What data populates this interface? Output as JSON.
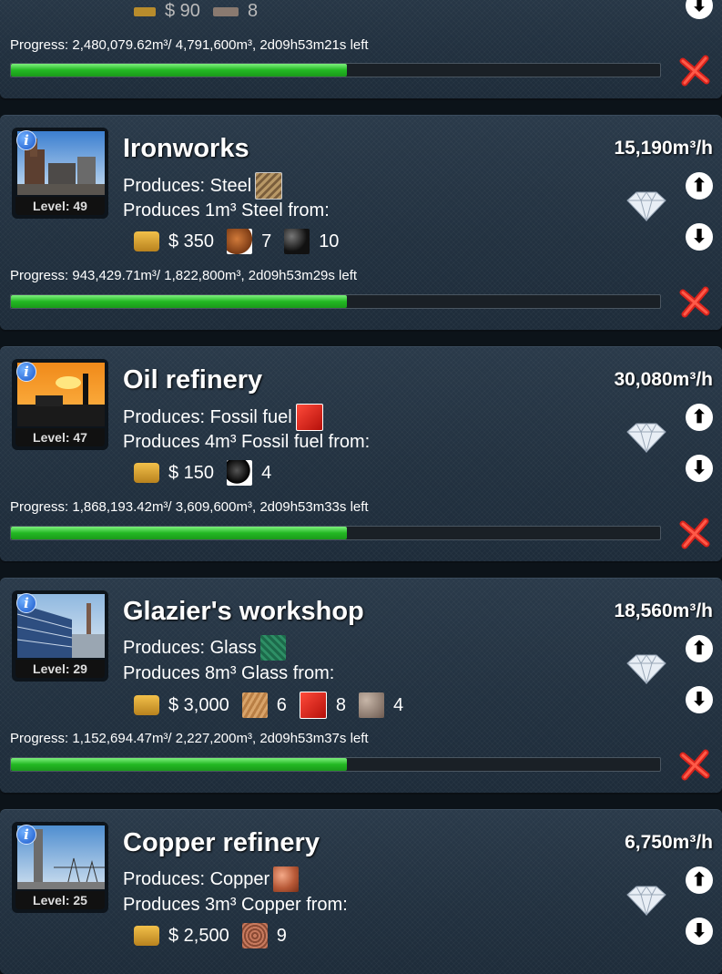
{
  "top_partial": {
    "cost_money": "$ 90",
    "cost_qty": "8",
    "progress_text": "Progress: 2,480,079.62m³/ 4,791,600m³, 2d09h53m21s left",
    "progress_fraction": 0.5176
  },
  "buildings": [
    {
      "name": "Ironworks",
      "rate": "15,190m³/h",
      "level": "Level: 49",
      "produces": "Produces: Steel",
      "produces_from": "Produces 1m³ Steel from:",
      "money": "$ 350",
      "inputs": [
        {
          "icon": "iron-ore-icon",
          "qty": "7"
        },
        {
          "icon": "coal-icon",
          "qty": "10"
        }
      ],
      "progress_text": "Progress: 943,429.71m³/ 1,822,800m³, 2d09h53m29s left",
      "progress_fraction": 0.5176
    },
    {
      "name": "Oil refinery",
      "rate": "30,080m³/h",
      "level": "Level: 47",
      "produces": "Produces: Fossil fuel",
      "produces_from": "Produces 4m³ Fossil fuel from:",
      "money": "$ 150",
      "inputs": [
        {
          "icon": "crude-oil-icon",
          "qty": "4"
        }
      ],
      "progress_text": "Progress: 1,868,193.42m³/ 3,609,600m³, 2d09h53m33s left",
      "progress_fraction": 0.5176
    },
    {
      "name": "Glazier's workshop",
      "rate": "18,560m³/h",
      "level": "Level: 29",
      "produces": "Produces: Glass",
      "produces_from": "Produces 8m³ Glass from:",
      "money": "$ 3,000",
      "inputs": [
        {
          "icon": "sand-icon",
          "qty": "6"
        },
        {
          "icon": "fuel-can-icon",
          "qty": "8"
        },
        {
          "icon": "stone-icon",
          "qty": "4"
        }
      ],
      "progress_text": "Progress: 1,152,694.47m³/ 2,227,200m³, 2d09h53m37s left",
      "progress_fraction": 0.5176
    },
    {
      "name": "Copper refinery",
      "rate": "6,750m³/h",
      "level": "Level: 25",
      "produces": "Produces: Copper",
      "produces_from": "Produces 3m³ Copper from:",
      "money": "$ 2,500",
      "inputs": [
        {
          "icon": "copper-ore-icon",
          "qty": "9"
        }
      ]
    }
  ]
}
